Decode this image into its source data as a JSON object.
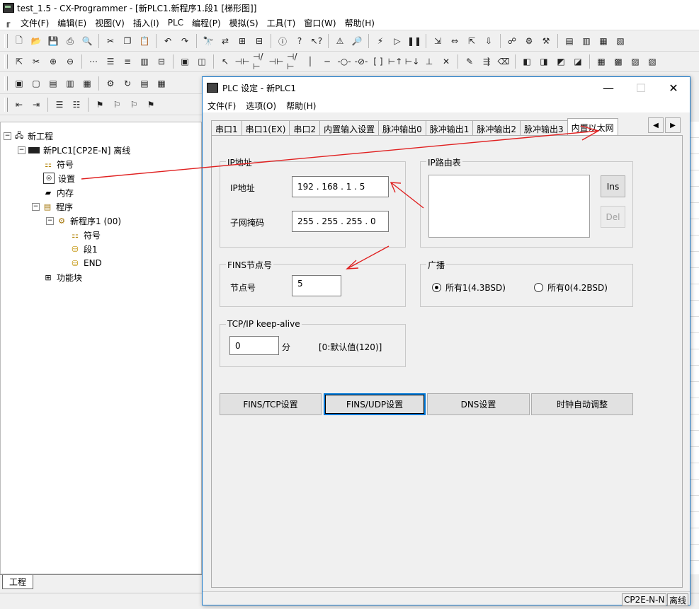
{
  "app": {
    "title": "test_1.5 - CX-Programmer - [新PLC1.新程序1.段1 [梯形图]]",
    "menu": [
      "文件(F)",
      "编辑(E)",
      "视图(V)",
      "插入(I)",
      "PLC",
      "编程(P)",
      "模拟(S)",
      "工具(T)",
      "窗口(W)",
      "帮助(H)"
    ]
  },
  "tree": {
    "root": "新工程",
    "plc": "新PLC1[CP2E-N] 离线",
    "symbols": "符号",
    "settings": "设置",
    "memory": "内存",
    "programs": "程序",
    "program1": "新程序1 (00)",
    "prog_symbols": "符号",
    "section1": "段1",
    "end": "END",
    "function_blocks": "功能块",
    "bottom_tab": "工程"
  },
  "dialog": {
    "title": "PLC 设定 - 新PLC1",
    "menu": [
      "文件(F)",
      "选项(O)",
      "帮助(H)"
    ],
    "tabs": [
      "串口1",
      "串口1(EX)",
      "串口2",
      "内置输入设置",
      "脉冲输出0",
      "脉冲输出1",
      "脉冲输出2",
      "脉冲输出3",
      "内置以太网"
    ],
    "active_tab": "内置以太网",
    "ip_group": {
      "legend": "IP地址",
      "ip_label": "IP地址",
      "ip_value": "192 . 168 .  1  .  5",
      "mask_label": "子网掩码",
      "mask_value": "255 . 255 . 255 .  0"
    },
    "route_group": {
      "legend": "IP路由表",
      "ins": "Ins",
      "del": "Del"
    },
    "fins_group": {
      "legend": "FINS节点号",
      "node_label": "节点号",
      "node_value": "5"
    },
    "broadcast_group": {
      "legend": "广播",
      "option1": "所有1(4.3BSD)",
      "option0": "所有0(4.2BSD)",
      "selected": "option1"
    },
    "keepalive_group": {
      "legend": "TCP/IP keep-alive",
      "value": "0",
      "unit": "分",
      "hint": "[0:默认值(120)]"
    },
    "buttons": {
      "fins_tcp": "FINS/TCP设置",
      "fins_udp": "FINS/UDP设置",
      "dns": "DNS设置",
      "clock": "时钟自动调整"
    },
    "status": {
      "model": "CP2E-N-N",
      "mode": "离线"
    }
  },
  "colors": {
    "accent": "#0078d7",
    "annotation": "#e02020"
  }
}
